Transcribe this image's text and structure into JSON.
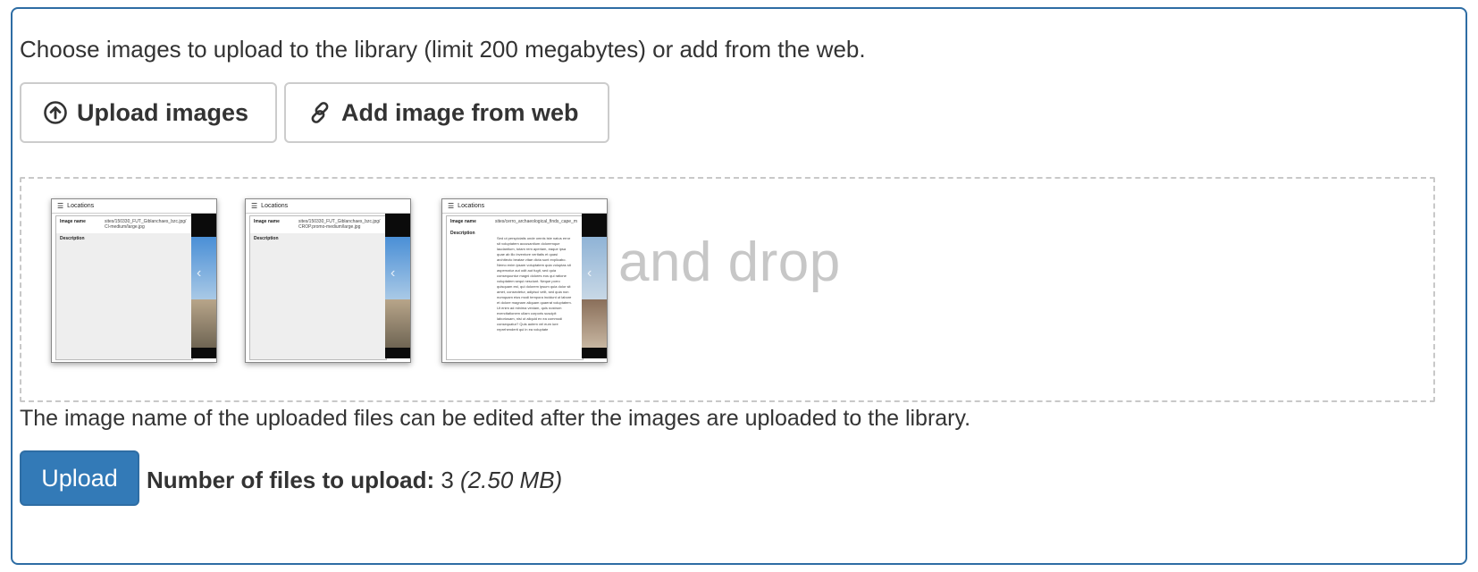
{
  "intro_text": "Choose images to upload to the library (limit 200 megabytes) or add from the web.",
  "buttons": {
    "upload_images": "Upload images",
    "add_from_web": "Add image from web",
    "upload": "Upload"
  },
  "dropzone": {
    "placeholder": "and drop",
    "thumbnails": [
      {
        "header": "Locations",
        "name_label": "Image name",
        "name_value": "sites/150330_FUT_Giblanchaes_bzc.jpg/Cl-medium/large.jpg",
        "desc_label": "Description",
        "desc_value": ""
      },
      {
        "header": "Locations",
        "name_label": "Image name",
        "name_value": "sites/150330_FUT_Giblanchaes_bzc.jpg/CROP.promo-medium/large.jpg",
        "desc_label": "Description",
        "desc_value": ""
      },
      {
        "header": "Locations",
        "name_label": "Image name",
        "name_value": "sites/cerro_archaeological_finds_cape_m",
        "desc_label": "Description",
        "desc_value": "Sed ut perspiciatis unde omnis iste natus error sit voluptatem accusantium doloremque laudantium, totam rem aperiam, eaque ipsa quae ab illo inventore veritatis et quasi architecto beatae vitae dicta sunt explicabo. Nemo enim ipsam voluptatem quia voluptas sit aspernatur aut odit aut fugit, sed quia consequuntur magni dolores eos qui ratione voluptatem sequi nesciunt. Neque porro quisquam est, qui dolorem ipsum quia dolor sit amet, consectetur, adipisci velit, sed quia non numquam eius modi tempora incidunt ut labore et dolore magnam aliquam quaerat voluptatem. Ut enim ad minima veniam, quis nostrum exercitationem ullam corporis suscipit laboriosam, nisi ut aliquid ex ea commodi consequatur? Quis autem vel eum iure reprehenderit qui in ea voluptate"
      }
    ]
  },
  "note_text": "The image name of the uploaded files can be edited after the images are uploaded to the library.",
  "file_count": {
    "label": "Number of files to upload:",
    "count": "3",
    "size": "(2.50 MB)"
  },
  "colors": {
    "primary": "#337ab7",
    "panel_border": "#2e6da4",
    "dropzone_border": "#c8c8c8",
    "placeholder_text": "#c7c7c7"
  },
  "icons": {
    "upload_images": "circle-arrow-up-icon",
    "add_from_web": "link-icon"
  }
}
